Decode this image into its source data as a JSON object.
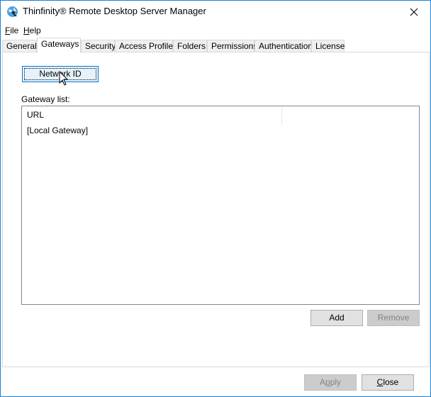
{
  "window": {
    "title": "Thinfinity® Remote Desktop Server Manager",
    "close_label": "✕",
    "accent_color": "#1883d7"
  },
  "menu": {
    "items": [
      {
        "label": "File",
        "mnemonic": "F",
        "rest": "ile"
      },
      {
        "label": "Help",
        "mnemonic": "H",
        "rest": "elp"
      }
    ]
  },
  "tabs": [
    {
      "label": "General",
      "active": false
    },
    {
      "label": "Gateways",
      "active": true
    },
    {
      "label": "Security",
      "active": false
    },
    {
      "label": "Access Profiles",
      "active": false
    },
    {
      "label": "Folders",
      "active": false
    },
    {
      "label": "Permissions",
      "active": false
    },
    {
      "label": "Authentication",
      "active": false
    },
    {
      "label": "License",
      "active": false
    }
  ],
  "gateways": {
    "network_id_button": "Network ID",
    "list_label": "Gateway list:",
    "columns": [
      "URL",
      ""
    ],
    "rows": [
      "[Local Gateway]"
    ],
    "add_button": "Add",
    "remove_button": "Remove"
  },
  "footer": {
    "apply_button": {
      "label": "Apply",
      "mnemonic": "p",
      "before": "A",
      "after": "ply"
    },
    "close_button": {
      "label": "Close",
      "mnemonic": "C",
      "before": "",
      "after": "lose"
    }
  }
}
